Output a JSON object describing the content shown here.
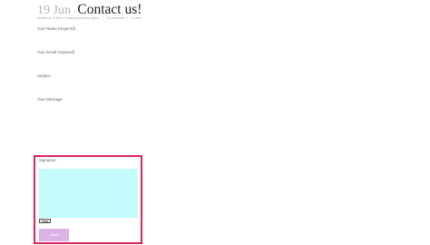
{
  "post": {
    "date": "19 Jun",
    "title": "Contact us!",
    "meta": {
      "posted": "Posted at 12:06 in Uncategorized",
      "by": "by admin",
      "comments": "0 Comments",
      "likes": "0 Likes"
    }
  },
  "form": {
    "name_label": "Your Name (required)",
    "email_label": "Your Email (required)",
    "subject_label": "Subject",
    "message_label": "Your Message",
    "signature_label": "Signature",
    "clear_label": "Clear",
    "send_label": "Send"
  },
  "colors": {
    "highlight_border": "#d6285a",
    "signature_pad": "#c4fbfb",
    "send_button": "#dcb3e6"
  }
}
